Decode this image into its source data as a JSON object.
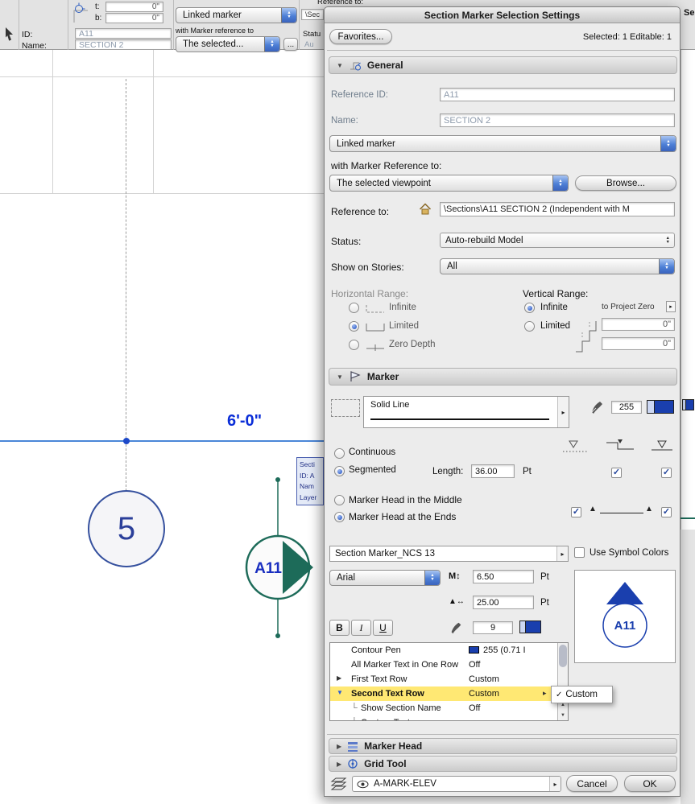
{
  "colors": {
    "accent_blue": "#3a66c4",
    "marker_green": "#1d6b59",
    "drawing_blue": "#0b2ed8",
    "pen_blue": "#1a3fae",
    "selection_yellow": "#ffe873"
  },
  "icons": {
    "disclosure_open": "▼",
    "disclosure_closed": "▶",
    "side_arrow": "▸",
    "up": "▲",
    "down": "▼",
    "check": "✓",
    "tree_branch": "└",
    "ellipsis_button": "...",
    "font_size_icon": "M↕",
    "marker_size_icon": "▲↔",
    "triangle_solid": "▲"
  },
  "toolbar": {
    "t_label": "t:",
    "t_value": "0\"",
    "b_label": "b:",
    "b_value": "0\"",
    "id_label": "ID:",
    "id_value": "A11",
    "name_label": "Name:",
    "name_value": "SECTION 2",
    "marker_type": "Linked marker",
    "with_marker_reference": "with Marker reference to",
    "reference_combo": "The selected...",
    "clipped_reference_label": "Reference to:",
    "clipped_path": "\\Sec",
    "clipped_status": "Statu",
    "clipped_auto": "Au",
    "right_panel_clipped": "Se"
  },
  "canvas": {
    "grid_bubble": "5",
    "marker_id": "A11",
    "dimension": "6'-0\"",
    "tooltip": [
      "Secti",
      "ID: A",
      "Nam",
      "Layer"
    ]
  },
  "dialog": {
    "title": "Section Marker Selection Settings",
    "favorites_button": "Favorites...",
    "selection_info": "Selected: 1 Editable: 1",
    "general": {
      "header": "General",
      "reference_id_label": "Reference ID:",
      "reference_id": "A11",
      "name_label": "Name:",
      "name": "SECTION 2",
      "marker_type": "Linked marker",
      "with_marker_reference_label": "with Marker Reference to:",
      "viewpoint": "The selected viewpoint",
      "browse_button": "Browse...",
      "reference_to_label": "Reference to:",
      "reference_path": "\\Sections\\A11 SECTION 2 (Independent with M",
      "status_label": "Status:",
      "status": "Auto-rebuild Model",
      "stories_label": "Show on Stories:",
      "stories": "All",
      "horizontal_range_label": "Horizontal Range:",
      "vertical_range_label": "Vertical Range:",
      "h_infinite": "Infinite",
      "h_limited": "Limited",
      "h_zero_depth": "Zero Depth",
      "v_infinite": "Infinite",
      "v_limited": "Limited",
      "to_project_zero": "to Project Zero",
      "offset_top": "0\"",
      "offset_bottom": "0\""
    },
    "marker": {
      "header": "Marker",
      "line_type": "Solid Line",
      "line_pen": "255",
      "continuous": "Continuous",
      "segmented": "Segmented",
      "length_label": "Length:",
      "length_value": "36.00",
      "length_unit": "Pt",
      "head_middle": "Marker Head in the Middle",
      "head_ends": "Marker Head at the Ends",
      "symbol_name": "Section Marker_NCS 13",
      "use_symbol_colors": "Use Symbol Colors",
      "font_name": "Arial",
      "font_size": "6.50",
      "font_size_unit": "Pt",
      "marker_size": "25.00",
      "marker_size_unit": "Pt",
      "bold": "B",
      "italic": "I",
      "underline": "U",
      "text_pen": "9",
      "preview_id": "A11",
      "params": [
        {
          "label": "Contour Pen",
          "value": "255 (0.71 I"
        },
        {
          "label": "All Marker Text in One Row",
          "value": "Off"
        },
        {
          "label": "First Text Row",
          "value": "Custom"
        },
        {
          "label": "Second Text Row",
          "value": "Custom"
        },
        {
          "label": "Show Section Name",
          "value": "Off"
        },
        {
          "label": "Custom Text",
          "value": ""
        }
      ],
      "popup_menu_item": "Custom"
    },
    "marker_head_header": "Marker Head",
    "grid_tool_header": "Grid Tool",
    "layer_name": "A-MARK-ELEV",
    "cancel_button": "Cancel",
    "ok_button": "OK"
  }
}
